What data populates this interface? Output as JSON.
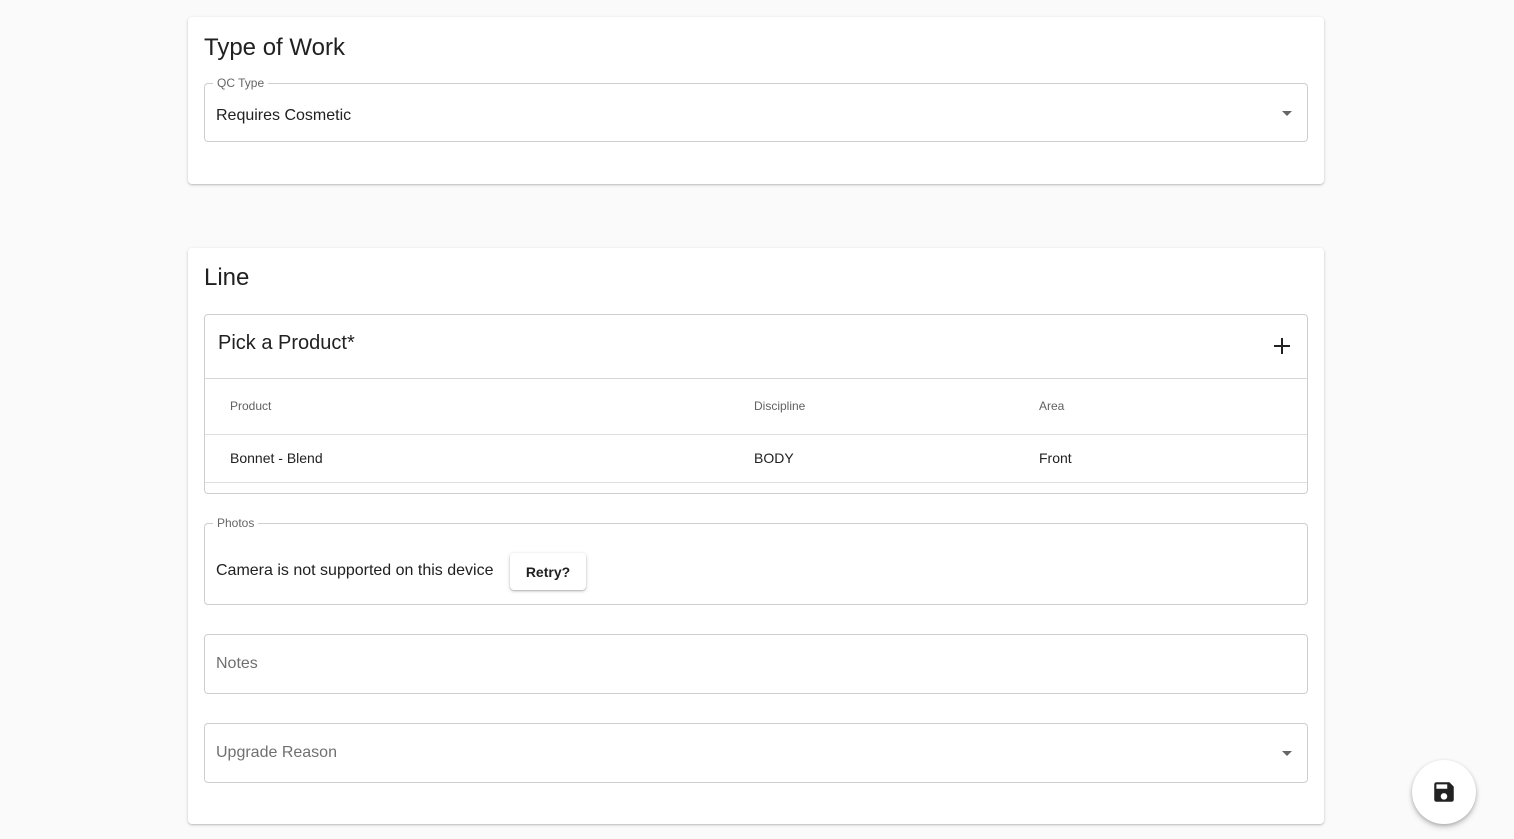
{
  "type_of_work": {
    "title": "Type of Work",
    "qc_type": {
      "label": "QC Type",
      "value": "Requires Cosmetic"
    }
  },
  "line": {
    "title": "Line",
    "product_panel": {
      "title": "Pick a Product*",
      "columns": [
        "Product",
        "Discipline",
        "Area"
      ],
      "rows": [
        {
          "product": "Bonnet - Blend",
          "discipline": "BODY",
          "area": "Front"
        }
      ]
    },
    "photos": {
      "label": "Photos",
      "message": "Camera is not supported on this device",
      "retry_label": "Retry?"
    },
    "notes": {
      "placeholder": "Notes"
    },
    "upgrade_reason": {
      "placeholder": "Upgrade Reason"
    }
  },
  "icons": {
    "add": "plus-icon",
    "dropdown": "chevron-down-icon",
    "save": "save-icon"
  }
}
